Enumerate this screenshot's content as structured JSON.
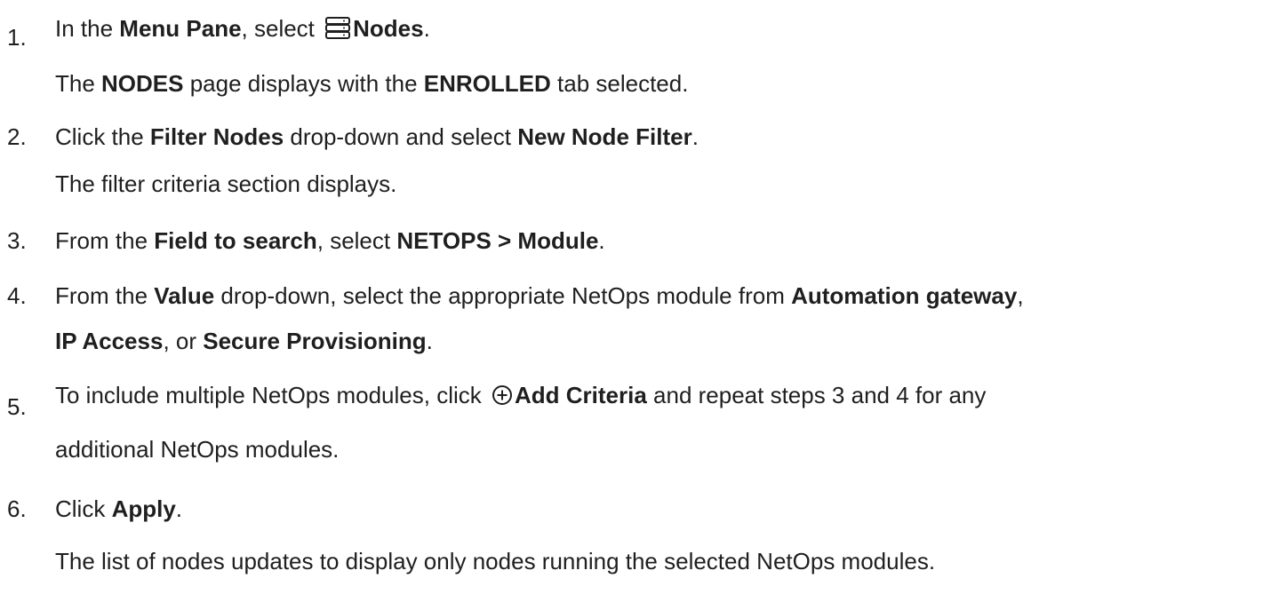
{
  "steps": [
    {
      "number": "1.",
      "line1": {
        "pre": "In the ",
        "b1": "Menu Pane",
        "mid": ", select ",
        "icon": "server-stack-icon",
        "b2": "Nodes",
        "post": "."
      },
      "line2": {
        "pre": "The ",
        "b1": "NODES",
        "mid": " page displays with the ",
        "b2": "ENROLLED",
        "post": " tab selected."
      }
    },
    {
      "number": "2.",
      "line1": {
        "pre": "Click the ",
        "b1": "Filter Nodes",
        "mid": " drop-down and select ",
        "b2": "New Node Filter",
        "post": "."
      },
      "line2": {
        "text": "The filter criteria section displays."
      }
    },
    {
      "number": "3.",
      "line1": {
        "pre": "From the ",
        "b1": "Field to search",
        "mid": ", select ",
        "b2": "NETOPS > Module",
        "post": "."
      }
    },
    {
      "number": "4.",
      "line1": {
        "pre": "From the ",
        "b1": "Value",
        "mid": " drop-down, select the appropriate NetOps module from ",
        "b2": "Automation gateway",
        "post": ","
      },
      "line2": {
        "b1": "IP Access",
        "mid": ", or ",
        "b2": "Secure Provisioning",
        "post": "."
      }
    },
    {
      "number": "5.",
      "line1": {
        "pre": "To include multiple NetOps modules, click ",
        "icon": "add-circle-icon",
        "b1": "Add Criteria",
        "post": " and repeat steps 3 and 4 for any"
      },
      "line2": {
        "text": "additional NetOps modules."
      }
    },
    {
      "number": "6.",
      "line1": {
        "pre": "Click ",
        "b1": "Apply",
        "post": "."
      },
      "line2": {
        "text": "The list of nodes updates to display only nodes running the selected NetOps modules."
      }
    }
  ]
}
